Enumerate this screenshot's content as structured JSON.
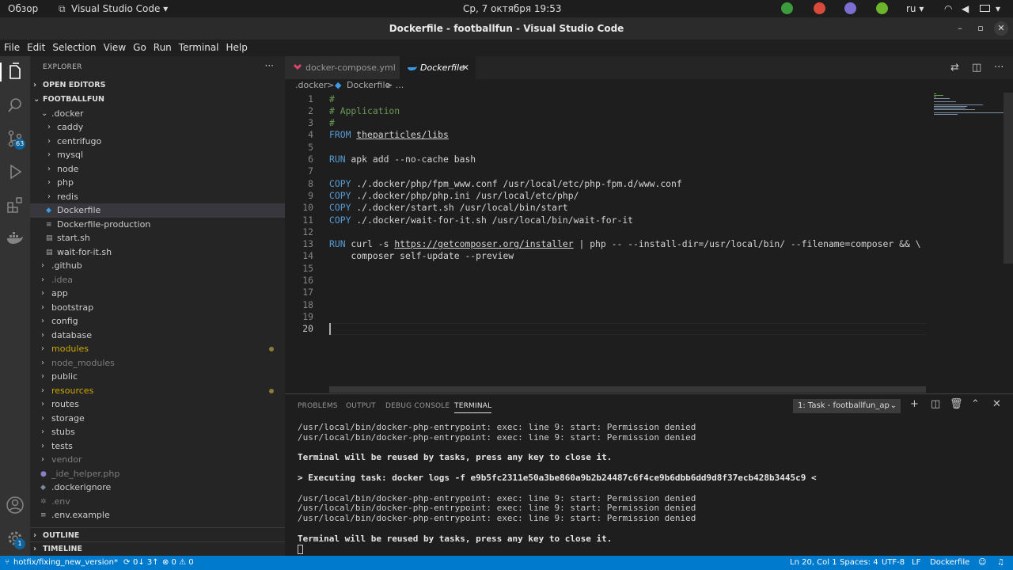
{
  "system_bar": {
    "activities": "Обзор",
    "app_menu": "Visual Studio Code ▾",
    "clock": "Ср, 7 октября  19:53",
    "language": "ru ▾"
  },
  "window": {
    "title": "Dockerfile - footballfun - Visual Studio Code"
  },
  "menu": [
    "File",
    "Edit",
    "Selection",
    "View",
    "Go",
    "Run",
    "Terminal",
    "Help"
  ],
  "activity_bar": {
    "scm_badge": "63",
    "settings_badge": "1"
  },
  "sidebar": {
    "header": "EXPLORER",
    "more": "···",
    "open_editors": "OPEN EDITORS",
    "project": "FOOTBALLFUN",
    "outline": "OUTLINE",
    "timeline": "TIMELINE",
    "items": [
      {
        "label": ".docker"
      },
      {
        "label": "caddy"
      },
      {
        "label": "centrifugo"
      },
      {
        "label": "mysql"
      },
      {
        "label": "node"
      },
      {
        "label": "php"
      },
      {
        "label": "redis"
      },
      {
        "label": "Dockerfile"
      },
      {
        "label": "Dockerfile-production"
      },
      {
        "label": "start.sh"
      },
      {
        "label": "wait-for-it.sh"
      },
      {
        "label": ".github"
      },
      {
        "label": ".idea"
      },
      {
        "label": "app"
      },
      {
        "label": "bootstrap"
      },
      {
        "label": "config"
      },
      {
        "label": "database"
      },
      {
        "label": "modules"
      },
      {
        "label": "node_modules"
      },
      {
        "label": "public"
      },
      {
        "label": "resources"
      },
      {
        "label": "routes"
      },
      {
        "label": "storage"
      },
      {
        "label": "stubs"
      },
      {
        "label": "tests"
      },
      {
        "label": "vendor"
      },
      {
        "label": "_ide_helper.php"
      },
      {
        "label": ".dockerignore"
      },
      {
        "label": ".env"
      },
      {
        "label": ".env.example"
      }
    ]
  },
  "tabs": [
    {
      "label": "docker-compose.yml"
    },
    {
      "label": "Dockerfile",
      "close": "✕"
    }
  ],
  "breadcrumb": [
    ".docker",
    ">",
    "Dockerfile",
    "> ..."
  ],
  "editor": {
    "line_numbers": [
      "1",
      "2",
      "3",
      "4",
      "5",
      "6",
      "7",
      "8",
      "9",
      "10",
      "11",
      "12",
      "13",
      "14",
      "15",
      "16",
      "17",
      "18",
      "19",
      "20"
    ],
    "lines": {
      "l1": "#",
      "l2": "# Application",
      "l3": "#",
      "l4_kw": "FROM",
      "l4_val": "theparticles/libs",
      "l6_kw": "RUN",
      "l6_rest": " apk add --no-cache bash",
      "l8_kw": "COPY",
      "l8_rest": " ./.docker/php/fpm_www.conf /usr/local/etc/php-fpm.d/www.conf",
      "l9_kw": "COPY",
      "l9_rest": " ./.docker/php/php.ini /usr/local/etc/php/",
      "l10_kw": "COPY",
      "l10_rest": " ./.docker/start.sh /usr/local/bin/start",
      "l11_kw": "COPY",
      "l11_rest": " ./.docker/wait-for-it.sh /usr/local/bin/wait-for-it",
      "l13_kw": "RUN",
      "l13_a": " curl -s ",
      "l13_url": "https://getcomposer.org/installer",
      "l13_b": " | php -- --install-dir=/usr/local/bin/ --filename=composer && \\",
      "l14": "    composer self-update --preview"
    }
  },
  "panel": {
    "tabs": [
      "PROBLEMS",
      "OUTPUT",
      "DEBUG CONSOLE",
      "TERMINAL"
    ],
    "terminal_select": "1: Task - footballfun_ap",
    "terminal_lines": [
      "/usr/local/bin/docker-php-entrypoint: exec: line 9: start: Permission denied",
      "/usr/local/bin/docker-php-entrypoint: exec: line 9: start: Permission denied",
      "",
      "Terminal will be reused by tasks, press any key to close it.",
      "",
      "> Executing task: docker logs -f e9b5fc2311e50a3be860a9b2b24487c6f4ce9b6dbb6dd9d8f37ecb428b3445c9 <",
      "",
      "/usr/local/bin/docker-php-entrypoint: exec: line 9: start: Permission denied",
      "/usr/local/bin/docker-php-entrypoint: exec: line 9: start: Permission denied",
      "/usr/local/bin/docker-php-entrypoint: exec: line 9: start: Permission denied",
      "",
      "Terminal will be reused by tasks, press any key to close it."
    ]
  },
  "status_bar": {
    "branch": "hotfix/fixing_new_version*",
    "sync": "0↓ 3↑",
    "problems": "⊗ 0 ⚠ 0",
    "position": "Ln 20, Col 1",
    "spaces": "Spaces: 4",
    "encoding": "UTF-8",
    "eol": "LF",
    "language": "Dockerfile"
  },
  "colors": {
    "accent": "#007acc",
    "keyword": "#569cd6",
    "comment": "#6a9955",
    "modified": "#cca700"
  }
}
